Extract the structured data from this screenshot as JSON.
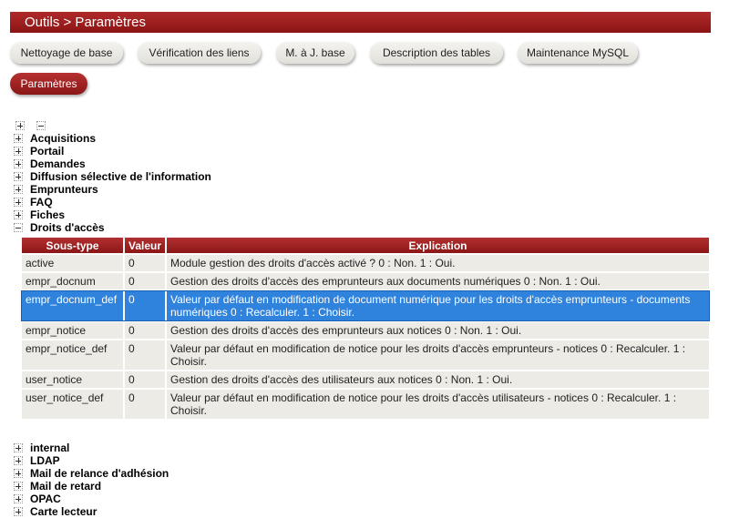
{
  "header": {
    "title": "Outils > Paramètres"
  },
  "tabs": [
    "Nettoyage de base",
    "Vérification des liens",
    "M. à J. base",
    "Description des tables",
    "Maintenance MySQL",
    "Paramètres"
  ],
  "sections_top": [
    "Acquisitions",
    "Portail",
    "Demandes",
    "Diffusion sélective de l'information",
    "Emprunteurs",
    "FAQ",
    "Fiches",
    "Droits d'accès"
  ],
  "table": {
    "headers": [
      "Sous-type",
      "Valeur",
      "Explication"
    ],
    "rows": [
      [
        "active",
        "0",
        "Module gestion des droits d'accès activé ? 0 : Non. 1 : Oui."
      ],
      [
        "empr_docnum",
        "0",
        "Gestion des droits d'accès des emprunteurs aux documents numériques 0 : Non. 1 : Oui."
      ],
      [
        "empr_docnum_def",
        "0",
        "Valeur par défaut en modification de document numérique pour les droits d'accès emprunteurs - documents numériques 0 : Recalculer. 1 : Choisir."
      ],
      [
        "empr_notice",
        "0",
        "Gestion des droits d'accès des emprunteurs aux notices 0 : Non. 1 : Oui."
      ],
      [
        "empr_notice_def",
        "0",
        "Valeur par défaut en modification de notice pour les droits d'accès emprunteurs - notices 0 : Recalculer. 1 : Choisir."
      ],
      [
        "user_notice",
        "0",
        "Gestion des droits d'accès des utilisateurs aux notices 0 : Non. 1 : Oui."
      ],
      [
        "user_notice_def",
        "0",
        "Valeur par défaut en modification de notice pour les droits d'accès utilisateurs - notices 0 : Recalculer. 1 : Choisir."
      ]
    ]
  },
  "sections_bottom": [
    "internal",
    "LDAP",
    "Mail de relance d'adhésion",
    "Mail de retard",
    "OPAC",
    "Carte lecteur"
  ]
}
